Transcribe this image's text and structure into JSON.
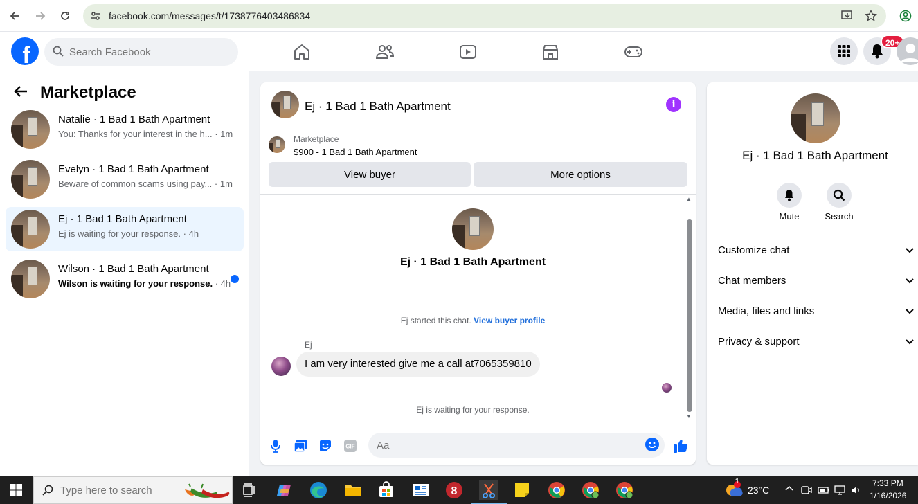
{
  "browser": {
    "url": "facebook.com/messages/t/1738776403486834"
  },
  "header": {
    "search_placeholder": "Search Facebook",
    "notification_count": "20+"
  },
  "sidebar": {
    "title": "Marketplace",
    "conversations": [
      {
        "name": "Natalie · 1 Bad 1 Bath Apartment",
        "preview": "You: Thanks for your interest in the h...",
        "time": " · 1m",
        "active": false,
        "unread": false
      },
      {
        "name": "Evelyn · 1 Bad 1 Bath Apartment",
        "preview": "Beware of common scams using pay...",
        "time": " · 1m",
        "active": false,
        "unread": false
      },
      {
        "name": "Ej · 1 Bad 1 Bath Apartment",
        "preview": "Ej is waiting for your response.",
        "time": " · 4h",
        "active": true,
        "unread": false
      },
      {
        "name": "Wilson · 1 Bad 1 Bath Apartment",
        "preview": "Wilson is waiting for your response.",
        "time": " · 4h",
        "active": false,
        "unread": true
      }
    ]
  },
  "chat": {
    "title": "Ej · 1 Bad 1 Bath Apartment",
    "marketplace_label": "Marketplace",
    "listing": "$900 - 1 Bad 1 Bath Apartment",
    "view_buyer": "View buyer",
    "more_options": "More options",
    "conversation_title": "Ej · 1 Bad 1 Bath Apartment",
    "started_text": "Ej started this chat.",
    "view_buyer_profile": "View buyer profile",
    "sender": "Ej",
    "message": "I am very interested give me a call at7065359810",
    "waiting": "Ej is waiting for your response.",
    "composer_placeholder": "Aa"
  },
  "right_panel": {
    "title": "Ej · 1 Bad 1 Bath Apartment",
    "mute": "Mute",
    "search": "Search",
    "sections": [
      "Customize chat",
      "Chat members",
      "Media, files and links",
      "Privacy & support"
    ]
  },
  "taskbar": {
    "search_placeholder": "Type here to search",
    "temperature": "23°C",
    "weather_badge": "1",
    "time": "7:33 PM",
    "date": "1/16/2026"
  }
}
